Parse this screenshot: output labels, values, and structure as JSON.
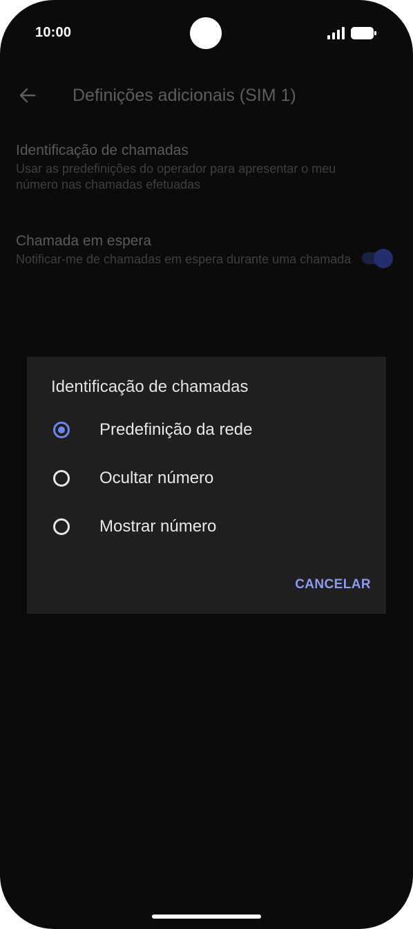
{
  "status_bar": {
    "time": "10:00",
    "icons": [
      "camera-cutout",
      "signal-icon",
      "battery-icon"
    ]
  },
  "app_bar": {
    "back_icon": "arrow-left-icon",
    "title": "Definições adicionais (SIM 1)"
  },
  "settings": [
    {
      "title": "Identificação de chamadas",
      "summary": "Usar as predefinições do operador para apresentar o meu número nas chamadas efetuadas"
    },
    {
      "title": "Chamada em espera",
      "summary": "Notificar-me de chamadas em espera durante uma chamada",
      "toggle_on": true
    }
  ],
  "dialog": {
    "title": "Identificação de chamadas",
    "options": [
      {
        "label": "Predefinição da rede",
        "selected": true
      },
      {
        "label": "Ocultar número",
        "selected": false
      },
      {
        "label": "Mostrar número",
        "selected": false
      }
    ],
    "cancel_label": "CANCELAR"
  },
  "colors": {
    "background": "#0b0b0b",
    "dialog_background": "#1f1f1f",
    "accent": "#6f86ea",
    "button_text": "#8b9bf1"
  }
}
